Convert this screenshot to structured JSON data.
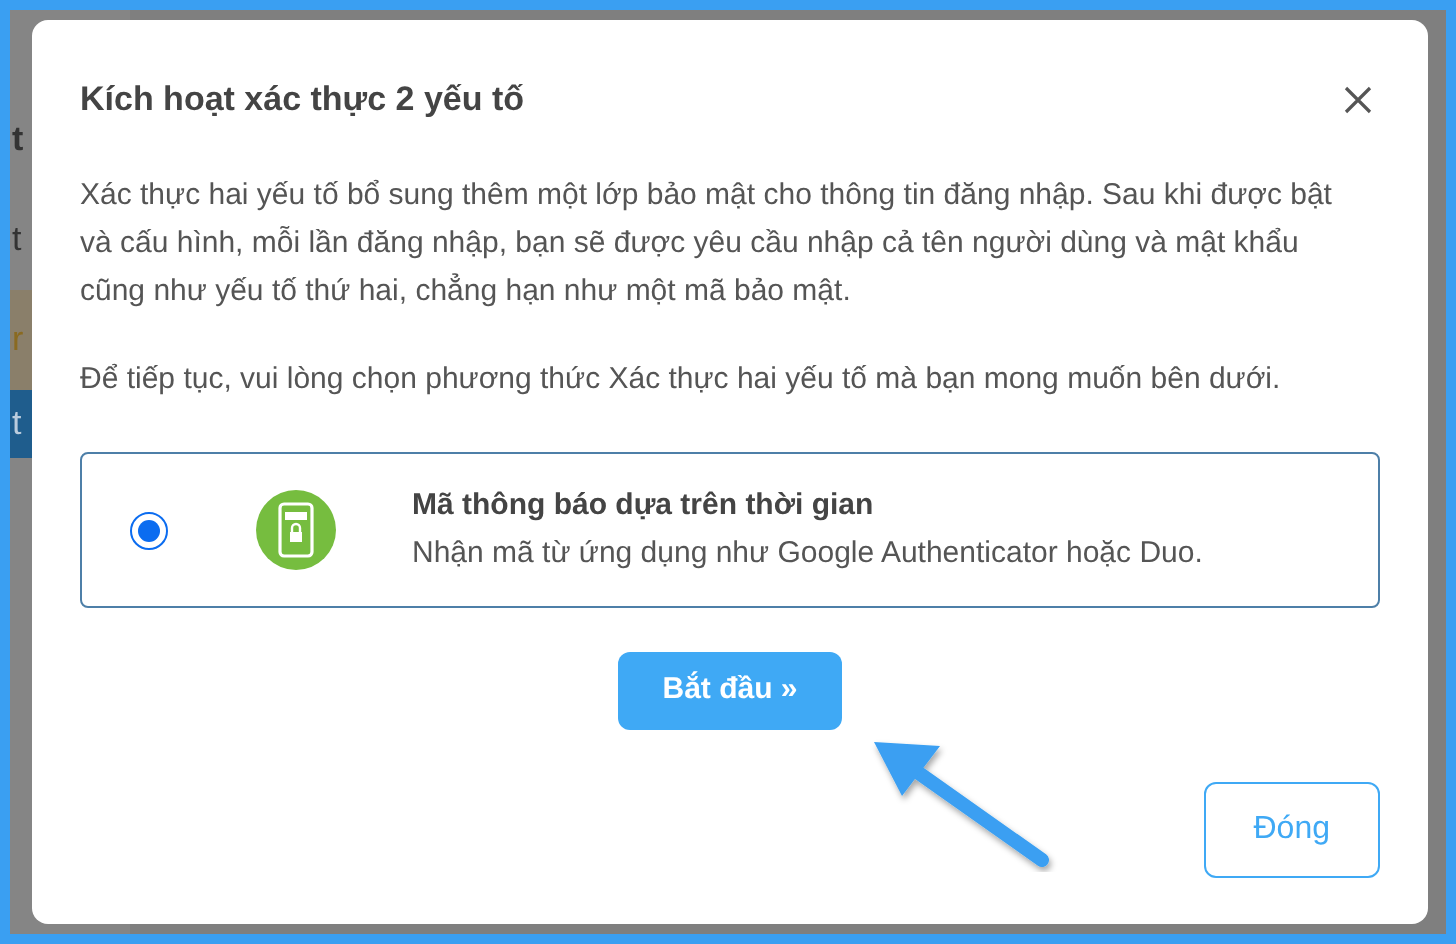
{
  "background_page": {
    "fragments": [
      {
        "text": "t",
        "kind": "heading"
      },
      {
        "text": "t",
        "kind": "text"
      },
      {
        "text": "r",
        "kind": "alert"
      },
      {
        "text": "t",
        "kind": "button"
      }
    ]
  },
  "dialog": {
    "title": "Kích hoạt xác thực 2 yếu tố",
    "paragraphs": [
      "Xác thực hai yếu tố bổ sung thêm một lớp bảo mật cho thông tin đăng nhập. Sau khi được bật và cấu hình, mỗi lần đăng nhập, bạn sẽ được yêu cầu nhập cả tên người dùng và mật khẩu cũng như yếu tố thứ hai, chẳng hạn như một mã bảo mật.",
      "Để tiếp tục, vui lòng chọn phương thức Xác thực hai yếu tố mà bạn mong muốn bên dưới."
    ],
    "options": [
      {
        "title": "Mã thông báo dựa trên thời gian",
        "description": "Nhận mã từ ứng dụng như Google Authenticator hoặc Duo.",
        "selected": true
      }
    ],
    "start_button": "Bắt đầu »",
    "close_button": "Đóng"
  }
}
